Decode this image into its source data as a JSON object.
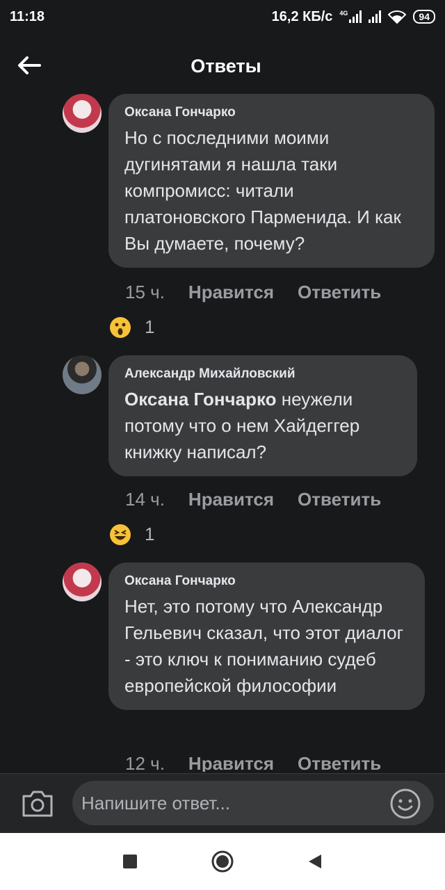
{
  "status_bar": {
    "time": "11:18",
    "net_speed": "16,2 КБ/с",
    "network_type": "4G",
    "battery": "94"
  },
  "header": {
    "title": "Ответы",
    "back_icon": "arrow-left-icon"
  },
  "comments": [
    {
      "author": "Оксана Гончарко",
      "mention": "",
      "text": "Но с последними моими дугинятами я нашла таки компромисс: читали платоновского Парменида. И как Вы думаете, почему?",
      "time": "15 ч.",
      "like_label": "Нравится",
      "reply_label": "Ответить",
      "reaction_count": "1",
      "reaction_icon": "wow-emoji-icon"
    },
    {
      "author": "Александр Михайловский",
      "mention": "Оксана Гончарко",
      "text": " неужели потому что о нем Хайдеггер книжку написал?",
      "time": "14 ч.",
      "like_label": "Нравится",
      "reply_label": "Ответить",
      "reaction_count": "1",
      "reaction_icon": "laughing-emoji-icon"
    },
    {
      "author": "Оксана Гончарко",
      "mention": "",
      "text": "Нет, это потому что Александр Гельевич сказал, что этот диалог - это ключ к пониманию судеб европейской философии",
      "time": "12 ч.",
      "like_label": "Нравится",
      "reply_label": "Ответить"
    }
  ],
  "composer": {
    "placeholder": "Напишите ответ...",
    "camera_icon": "camera-icon",
    "emoji_icon": "smiley-icon"
  },
  "colors": {
    "background": "#18191a",
    "bubble": "#3a3b3c",
    "muted_text": "#9a9ca1",
    "reaction_yellow": "#f7c23a"
  }
}
